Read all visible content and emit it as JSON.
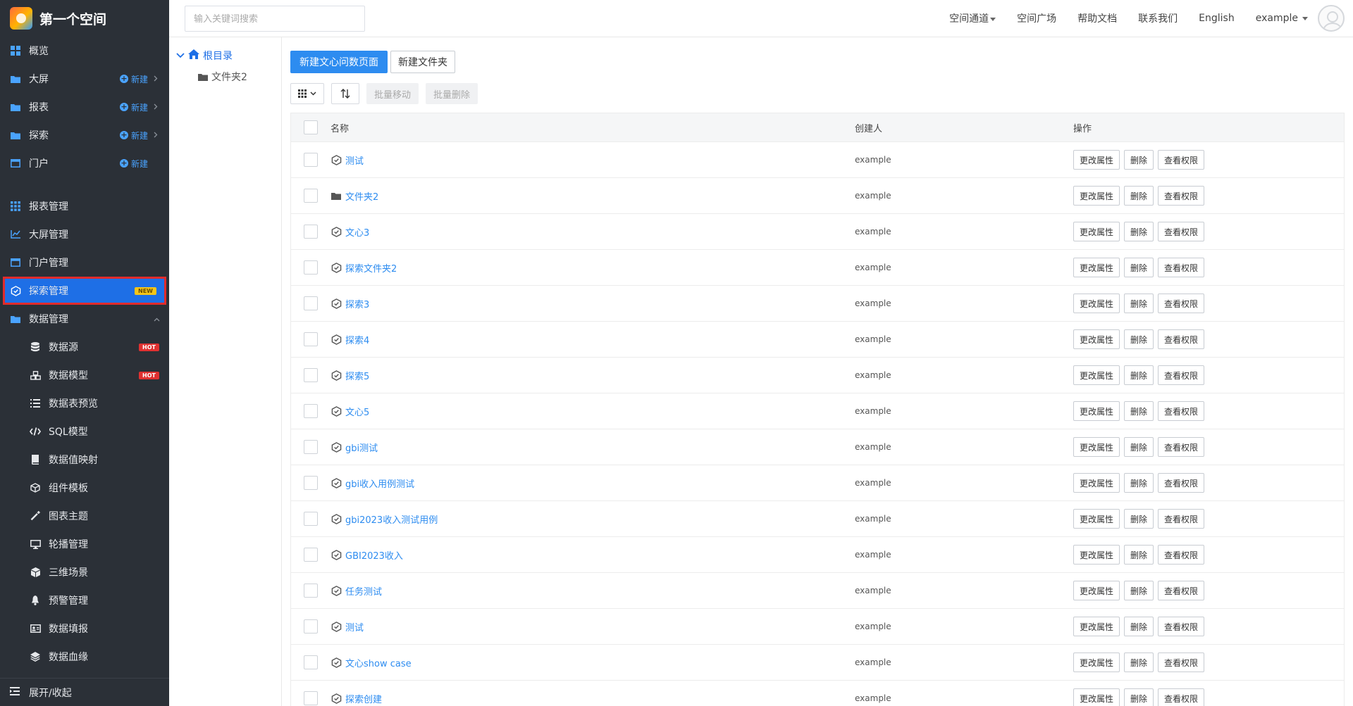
{
  "brand": {
    "title": "第一个空间"
  },
  "sidebar": {
    "new_label": "新建",
    "top_items": [
      {
        "label": "概览",
        "icon": "grid-icon",
        "new": false,
        "chevron": false
      },
      {
        "label": "大屏",
        "icon": "folder-icon",
        "new": true,
        "chevron": true
      },
      {
        "label": "报表",
        "icon": "folder-icon",
        "new": true,
        "chevron": true
      },
      {
        "label": "探索",
        "icon": "folder-icon",
        "new": true,
        "chevron": true
      },
      {
        "label": "门户",
        "icon": "window-icon",
        "new": true,
        "chevron": false
      }
    ],
    "mgmt_items": [
      {
        "label": "报表管理",
        "icon": "apps-icon"
      },
      {
        "label": "大屏管理",
        "icon": "line-chart-icon"
      },
      {
        "label": "门户管理",
        "icon": "window-icon"
      }
    ],
    "active_item": {
      "label": "探索管理",
      "badge": "NEW",
      "icon": "hexagon-icon"
    },
    "data_group": {
      "label": "数据管理",
      "icon": "folder-icon",
      "expanded": true
    },
    "sub_items": [
      {
        "label": "数据源",
        "badge": "HOT",
        "icon": "database-icon"
      },
      {
        "label": "数据模型",
        "badge": "HOT",
        "icon": "cubes-icon"
      },
      {
        "label": "数据表预览",
        "badge": "",
        "icon": "list-icon"
      },
      {
        "label": "SQL模型",
        "badge": "",
        "icon": "code-icon"
      },
      {
        "label": "数据值映射",
        "badge": "",
        "icon": "book-icon"
      },
      {
        "label": "组件模板",
        "badge": "",
        "icon": "cube-outline-icon"
      },
      {
        "label": "图表主题",
        "badge": "",
        "icon": "magic-wand-icon"
      },
      {
        "label": "轮播管理",
        "badge": "",
        "icon": "monitor-icon"
      },
      {
        "label": "三维场景",
        "badge": "",
        "icon": "cube-icon"
      },
      {
        "label": "预警管理",
        "badge": "",
        "icon": "bell-icon"
      },
      {
        "label": "数据填报",
        "badge": "",
        "icon": "id-card-icon"
      },
      {
        "label": "数据血缘",
        "badge": "",
        "icon": "layers-icon"
      }
    ],
    "collapse_label": "展开/收起"
  },
  "header": {
    "search_placeholder": "输入关键词搜索",
    "nav": [
      "空间通道",
      "空间广场",
      "帮助文档",
      "联系我们",
      "English"
    ],
    "user": "example"
  },
  "tree": {
    "root": "根目录",
    "child": "文件夹2"
  },
  "toolbar": {
    "new_page": "新建文心问数页面",
    "new_folder": "新建文件夹",
    "batch_move": "批量移动",
    "batch_delete": "批量删除"
  },
  "table": {
    "columns": [
      "名称",
      "创建人",
      "操作"
    ],
    "ops": [
      "更改属性",
      "删除",
      "查看权限"
    ],
    "rows": [
      {
        "name": "测试",
        "type": "explore",
        "creator": "example"
      },
      {
        "name": "文件夹2",
        "type": "folder",
        "creator": "example"
      },
      {
        "name": "文心3",
        "type": "explore",
        "creator": "example"
      },
      {
        "name": "探索文件夹2",
        "type": "explore",
        "creator": "example"
      },
      {
        "name": "探索3",
        "type": "explore",
        "creator": "example"
      },
      {
        "name": "探索4",
        "type": "explore",
        "creator": "example"
      },
      {
        "name": "探索5",
        "type": "explore",
        "creator": "example"
      },
      {
        "name": "文心5",
        "type": "explore",
        "creator": "example"
      },
      {
        "name": "gbi测试",
        "type": "explore",
        "creator": "example"
      },
      {
        "name": "gbi收入用例测试",
        "type": "explore",
        "creator": "example"
      },
      {
        "name": "gbi2023收入测试用例",
        "type": "explore",
        "creator": "example"
      },
      {
        "name": "GBI2023收入",
        "type": "explore",
        "creator": "example"
      },
      {
        "name": "任务测试",
        "type": "explore",
        "creator": "example"
      },
      {
        "name": "测试",
        "type": "explore",
        "creator": "example"
      },
      {
        "name": "文心show case",
        "type": "explore",
        "creator": "example"
      },
      {
        "name": "探索创建",
        "type": "explore",
        "creator": "example"
      }
    ]
  },
  "colors": {
    "sidebar_bg": "#2b3037",
    "accent": "#2d8cf0",
    "active_bg": "#1e6fe6",
    "highlight_border": "#e12b2b",
    "badge_new": "#f5c518",
    "badge_hot": "#e03131"
  }
}
